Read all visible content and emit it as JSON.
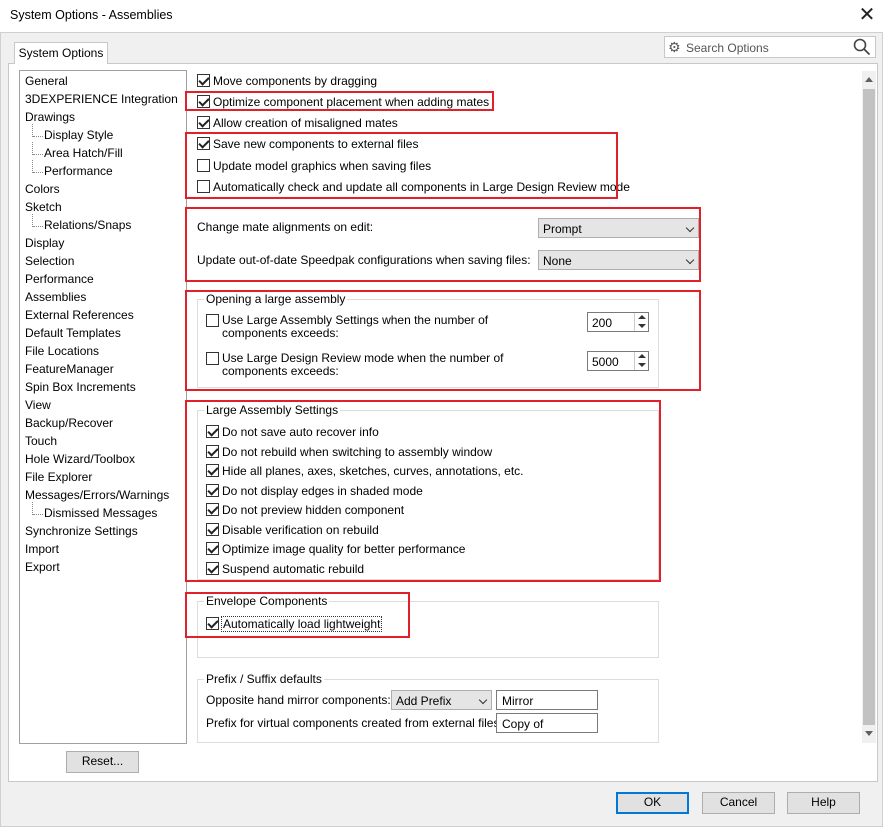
{
  "window": {
    "title": "System Options - Assemblies",
    "close": "✕"
  },
  "tab": {
    "label": "System Options"
  },
  "search": {
    "placeholder": "Search Options"
  },
  "tree": {
    "items": [
      {
        "label": "General",
        "level": 0
      },
      {
        "label": "3DEXPERIENCE Integration",
        "level": 0
      },
      {
        "label": "Drawings",
        "level": 0
      },
      {
        "label": "Display Style",
        "level": 1
      },
      {
        "label": "Area Hatch/Fill",
        "level": 1
      },
      {
        "label": "Performance",
        "level": 1
      },
      {
        "label": "Colors",
        "level": 0
      },
      {
        "label": "Sketch",
        "level": 0
      },
      {
        "label": "Relations/Snaps",
        "level": 1
      },
      {
        "label": "Display",
        "level": 0
      },
      {
        "label": "Selection",
        "level": 0
      },
      {
        "label": "Performance",
        "level": 0
      },
      {
        "label": "Assemblies",
        "level": 0,
        "selected": true
      },
      {
        "label": "External References",
        "level": 0
      },
      {
        "label": "Default Templates",
        "level": 0
      },
      {
        "label": "File Locations",
        "level": 0
      },
      {
        "label": "FeatureManager",
        "level": 0
      },
      {
        "label": "Spin Box Increments",
        "level": 0
      },
      {
        "label": "View",
        "level": 0
      },
      {
        "label": "Backup/Recover",
        "level": 0
      },
      {
        "label": "Touch",
        "level": 0
      },
      {
        "label": "Hole Wizard/Toolbox",
        "level": 0
      },
      {
        "label": "File Explorer",
        "level": 0
      },
      {
        "label": "Messages/Errors/Warnings",
        "level": 0
      },
      {
        "label": "Dismissed Messages",
        "level": 1
      },
      {
        "label": "Synchronize Settings",
        "level": 0
      },
      {
        "label": "Import",
        "level": 0
      },
      {
        "label": "Export",
        "level": 0
      }
    ]
  },
  "options": {
    "move_by_dragging": {
      "label": "Move components by dragging",
      "checked": true
    },
    "optimize_placement": {
      "label": "Optimize component placement when adding mates",
      "checked": true
    },
    "misaligned_mates": {
      "label": "Allow creation of misaligned mates",
      "checked": true
    },
    "save_external": {
      "label": "Save new components to external files",
      "checked": true
    },
    "update_graphics": {
      "label": "Update model graphics when saving files",
      "checked": false
    },
    "auto_check_ldr": {
      "label": "Automatically check and update all components in Large Design Review mode",
      "checked": false
    }
  },
  "mate_align": {
    "label": "Change mate alignments on edit:",
    "value": "Prompt"
  },
  "speedpak": {
    "label": "Update out-of-date Speedpak configurations when saving files:",
    "value": "None"
  },
  "opening_large": {
    "title": "Opening a large assembly",
    "las": {
      "label1": "Use Large Assembly Settings when the number of",
      "label2": "components exceeds:",
      "checked": false,
      "value": "200"
    },
    "ldr": {
      "label1": "Use Large Design Review mode when the number of",
      "label2": "components exceeds:",
      "checked": false,
      "value": "5000"
    }
  },
  "large_settings": {
    "title": "Large Assembly Settings",
    "items": [
      {
        "label": "Do not save auto recover info",
        "checked": true
      },
      {
        "label": "Do not rebuild when switching to assembly window",
        "checked": true
      },
      {
        "label": "Hide all planes, axes, sketches, curves, annotations, etc.",
        "checked": true
      },
      {
        "label": "Do not display edges in shaded mode",
        "checked": true
      },
      {
        "label": "Do not preview hidden component",
        "checked": true
      },
      {
        "label": "Disable verification on rebuild",
        "checked": true
      },
      {
        "label": "Optimize image quality for better performance",
        "checked": true
      },
      {
        "label": "Suspend automatic rebuild",
        "checked": true
      }
    ]
  },
  "envelope": {
    "title": "Envelope Components",
    "auto_lightweight": {
      "label": "Automatically load lightweight",
      "checked": true
    }
  },
  "prefix": {
    "title": "Prefix / Suffix defaults",
    "mirror_label": "Opposite hand mirror components:",
    "mirror_select": "Add Prefix",
    "mirror_text": "Mirror",
    "virtual_label": "Prefix for virtual components created from external files:",
    "virtual_text": "Copy of"
  },
  "buttons": {
    "reset": "Reset...",
    "ok": "OK",
    "cancel": "Cancel",
    "help": "Help"
  },
  "colors": {
    "highlight": "#e0202a",
    "accent": "#0078d7"
  }
}
